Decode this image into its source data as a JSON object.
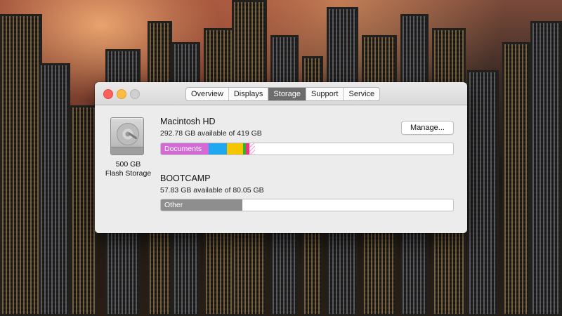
{
  "window": {
    "tabs": [
      {
        "label": "Overview",
        "active": false
      },
      {
        "label": "Displays",
        "active": false
      },
      {
        "label": "Storage",
        "active": true
      },
      {
        "label": "Support",
        "active": false
      },
      {
        "label": "Service",
        "active": false
      }
    ]
  },
  "storage": {
    "disk_caption_line1": "500 GB",
    "disk_caption_line2": "Flash Storage",
    "manage_label": "Manage...",
    "volumes": [
      {
        "name": "Macintosh HD",
        "available": "292.78 GB available of 419 GB",
        "segments": [
          {
            "label": "Documents",
            "color": "#d36ad6",
            "fraction": 0.163
          },
          {
            "label": "",
            "color": "#1fa8f0",
            "fraction": 0.062
          },
          {
            "label": "",
            "color": "#f5c500",
            "fraction": 0.055
          },
          {
            "label": "",
            "color": "#2ab52a",
            "fraction": 0.01
          },
          {
            "label": "",
            "color": "#f4308a",
            "fraction": 0.012
          },
          {
            "label": "",
            "color": "hatch",
            "fraction": 0.02
          }
        ]
      },
      {
        "name": "BOOTCAMP",
        "available": "57.83 GB available of 80.05 GB",
        "segments": [
          {
            "label": "Other",
            "color": "#8e8e8e",
            "fraction": 0.278
          }
        ]
      }
    ]
  },
  "colors": {
    "accent_tab": "#6d6d6d",
    "close": "#fc605c",
    "minimize": "#fdbc40"
  }
}
